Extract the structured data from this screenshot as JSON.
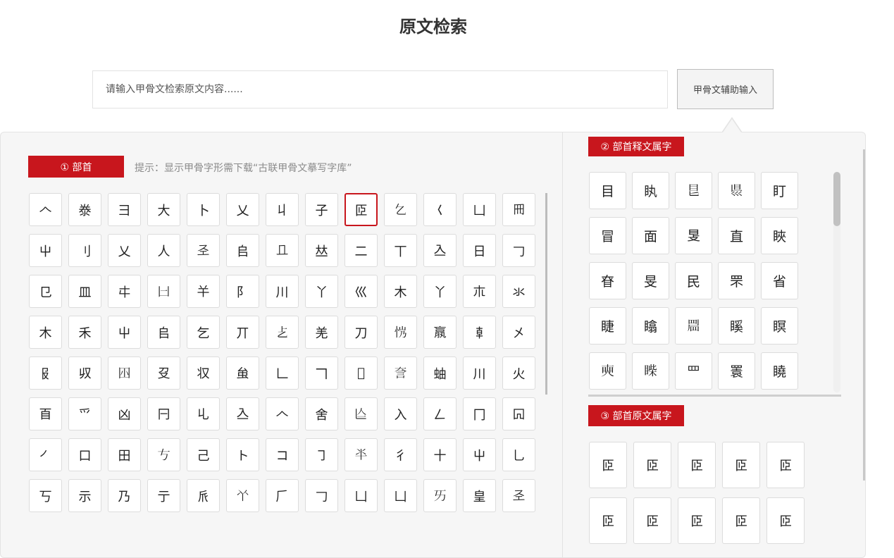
{
  "page": {
    "title": "原文检索"
  },
  "search": {
    "placeholder": "请输入甲骨文检索原文内容......",
    "assist_button_label": "甲骨文辅助输入"
  },
  "radical_panel": {
    "tag": "① 部首",
    "hint": "提示：显示甲骨字形需下载“古联甲骨文摹写字库”",
    "selected_index": 8,
    "glyphs": [
      "𠆢",
      "𣳾",
      "彐",
      "大",
      "卜",
      "乂",
      "丩",
      "子",
      "𦣝",
      "𠃉",
      "𡿨",
      "凵",
      "𠕁",
      "屮",
      "刂",
      "乂",
      "人",
      "𢀖",
      "𠂤",
      "𠀃",
      "𠀤",
      "二",
      "丅",
      "𠓛",
      "日",
      "𠃌",
      "㔾",
      "皿",
      "㐄",
      "𠙵",
      "𢆉",
      "阝",
      "川",
      "丫",
      "巛",
      "木",
      "丫",
      "𣎳",
      "氺",
      "木",
      "禾",
      "屮",
      "𠂤",
      "乞",
      "丌",
      "𠧒",
      "羌",
      "刀",
      "𢘏",
      "𣎆",
      "𠦝",
      "㐅",
      "𠬝",
      "𠬞",
      "𡆧",
      "𠬛",
      "𠬧",
      "𧈧",
      "𠃊",
      "𠃍",
      "𠃒",
      "𧥢",
      "蚰",
      "川",
      "火",
      "𦣻",
      "爫",
      "凶",
      "𠔼",
      "𠃏",
      "𠓛",
      "𠆢",
      "舍",
      "𠆦",
      "入",
      "𠃋",
      "冂",
      "𠕄",
      "㇒",
      "口",
      "田",
      "𠀁",
      "己",
      "ト",
      "コ",
      "㇆",
      "𠦂",
      "彳",
      "十",
      "屮",
      "乚",
      "丂",
      "示",
      "乃",
      "亍",
      "𠂢",
      "𠁥",
      "𠂆",
      "𠃌",
      "凵",
      "凵",
      "𠀅",
      "皇",
      "𢀖"
    ]
  },
  "paraphrase_panel": {
    "tag": "② 部首释文属字",
    "glyphs": [
      "目",
      "䀓",
      "𥃩",
      "𥄉",
      "盯",
      "冒",
      "面",
      "𥄎",
      "直",
      "䀹",
      "眘",
      "旻",
      "民",
      "罘",
      "省",
      "睫",
      "䁯",
      "𥆞",
      "𥉐",
      "瞑",
      "𥇛",
      "𥈐",
      "罒",
      "瞏",
      "䁱"
    ]
  },
  "original_panel": {
    "tag": "③ 部首原文属字",
    "glyphs": [
      "𦣝",
      "𦣝",
      "𦣝",
      "𦣝",
      "𦣝",
      "𦣝",
      "𦣝",
      "𦣝",
      "𦣝",
      "𦣝"
    ]
  }
}
